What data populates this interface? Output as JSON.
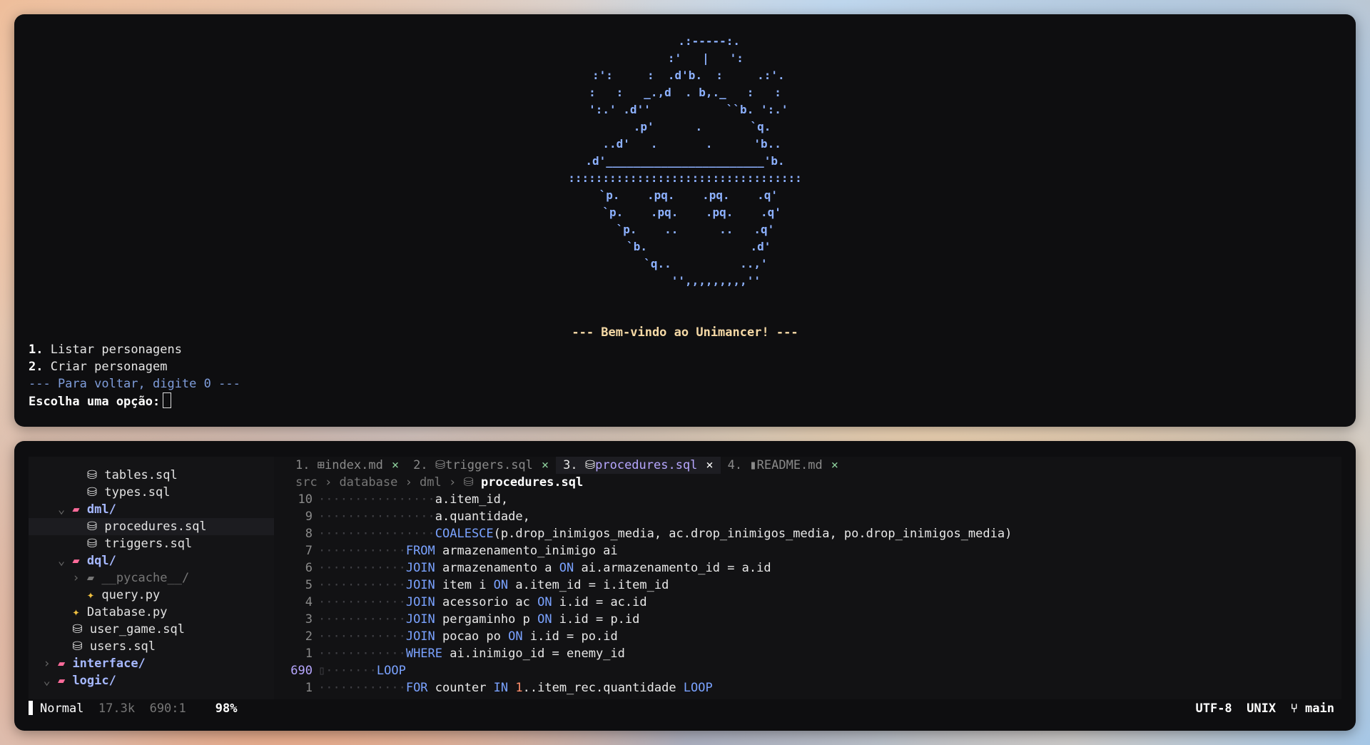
{
  "terminal": {
    "ascii_art": "       .:-----:.\n      :'   |   ':\n :':     :  .d'b.  :     .:'.\n:   :   _.,d  . b,._   :   :\n ':.' .d''           ``b. ':.'\n     .p'      .       `q.\n  ..d'   .       .      'b..\n.d'_______________________'b.\n::::::::::::::::::::::::::::::::::\n `p.    .pq.    .pq.    .q'\n  `p.    .pq.    .pq.    .q'\n   `p.    ..      ..   .q'\n    `b.               .d'\n      `q..          ..,'\n         '',,,,,,,,,''",
    "welcome": "--- Bem-vindo ao Unimancer! ---",
    "menu_1_num": "1.",
    "menu_1_label": "Listar personagens",
    "menu_2_num": "2.",
    "menu_2_label": "Criar personagem",
    "back_hint": "--- Para voltar, digite 0 ---",
    "prompt": "Escolha uma opção:"
  },
  "tree": {
    "items": [
      {
        "indent": "        ",
        "icon": "⛁",
        "label": "tables.sql"
      },
      {
        "indent": "        ",
        "icon": "⛁",
        "label": "types.sql"
      },
      {
        "indent": "    ⌄ ",
        "icon": "▰",
        "label": "dml/"
      },
      {
        "indent": "        ",
        "icon": "⛁",
        "label": "procedures.sql"
      },
      {
        "indent": "        ",
        "icon": "⛁",
        "label": "triggers.sql"
      },
      {
        "indent": "    ⌄ ",
        "icon": "▰",
        "label": "dql/"
      },
      {
        "indent": "      › ",
        "icon": "▰",
        "label": "__pycache__/"
      },
      {
        "indent": "        ",
        "icon": "✦",
        "label": "query.py"
      },
      {
        "indent": "      ",
        "icon": "✦",
        "label": "Database.py"
      },
      {
        "indent": "      ",
        "icon": "⛁",
        "label": "user_game.sql"
      },
      {
        "indent": "      ",
        "icon": "⛁",
        "label": "users.sql"
      },
      {
        "indent": "  › ",
        "icon": "▰",
        "label": "interface/"
      },
      {
        "indent": "  ⌄ ",
        "icon": "▰",
        "label": "logic/"
      }
    ]
  },
  "tabs": [
    {
      "num": "1.",
      "icon": "⊞",
      "name": "index.md",
      "close": "×"
    },
    {
      "num": "2.",
      "icon": "⛁",
      "name": "triggers.sql",
      "close": "×"
    },
    {
      "num": "3.",
      "icon": "⛁",
      "name": "procedures.sql",
      "close": "×"
    },
    {
      "num": "4.",
      "icon": "▮",
      "name": "README.md",
      "close": "×"
    }
  ],
  "breadcrumb": {
    "parts": [
      "src",
      "database",
      "dml"
    ],
    "sep": " › ",
    "icon": "⛁",
    "file": "procedures.sql"
  },
  "code_lines": [
    {
      "n": "10",
      "dots": "················",
      "text": "a.item_id,"
    },
    {
      "n": "9",
      "dots": "················",
      "text": "a.quantidade,"
    },
    {
      "n": "8",
      "dots": "················",
      "fn": "COALESCE",
      "text": "(p.drop_inimigos_media, ac.drop_inimigos_media, po.drop_inimigos_media)"
    },
    {
      "n": "7",
      "dots": "············",
      "kw": "FROM",
      "text": " armazenamento_inimigo ai"
    },
    {
      "n": "6",
      "dots": "············",
      "kw": "JOIN",
      "text": " armazenamento a ",
      "kw2": "ON",
      "text2": " ai.armazenamento_id = a.id"
    },
    {
      "n": "5",
      "dots": "············",
      "kw": "JOIN",
      "text": " item i ",
      "kw2": "ON",
      "text2": " a.item_id = i.item_id"
    },
    {
      "n": "4",
      "dots": "············",
      "kw": "JOIN",
      "text": " acessorio ac ",
      "kw2": "ON",
      "text2": " i.id = ac.id"
    },
    {
      "n": "3",
      "dots": "············",
      "kw": "JOIN",
      "text": " pergaminho p ",
      "kw2": "ON",
      "text2": " i.id = p.id"
    },
    {
      "n": "2",
      "dots": "············",
      "kw": "JOIN",
      "text": " pocao po ",
      "kw2": "ON",
      "text2": " i.id = po.id"
    },
    {
      "n": "1",
      "dots": "············",
      "kw": "WHERE",
      "text": " ai.inimigo_id = enemy_id"
    },
    {
      "n": "690",
      "dots": "▯·······",
      "kw": "LOOP",
      "text": "",
      "current": true
    },
    {
      "n": "1",
      "dots": "············",
      "kw": "FOR",
      "text": " counter ",
      "kw2": "IN",
      "num": " 1",
      "text2": "..item_rec.quantidade ",
      "kw3": "LOOP"
    }
  ],
  "status": {
    "mode": "Normal",
    "size": "17.3k",
    "pos": "690:1",
    "percent": "98%",
    "encoding": "UTF-8",
    "format": "UNIX",
    "branch_icon": "⑂",
    "branch": "main"
  },
  "colors": {
    "accent": "#b7a7ff",
    "keyword": "#7aa2ff",
    "ascii": "#8db1ff",
    "welcome": "#f5d9a6",
    "folder_icon": "#ff6b9a",
    "python_icon": "#f0c040"
  }
}
